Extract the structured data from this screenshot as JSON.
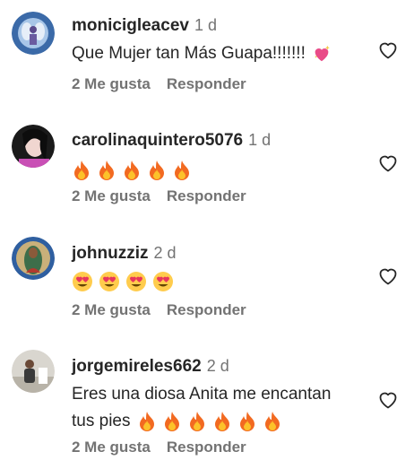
{
  "comments": [
    {
      "username": "monicigleacev",
      "time": "1 d",
      "text": "Que Mujer tan Más Guapa!!!!!!!",
      "emojis": [
        "sparkling-heart"
      ],
      "likes_label": "2 Me gusta",
      "reply_label": "Responder"
    },
    {
      "username": "carolinaquintero5076",
      "time": "1 d",
      "text": "",
      "emojis": [
        "fire",
        "fire",
        "fire",
        "fire",
        "fire"
      ],
      "likes_label": "2 Me gusta",
      "reply_label": "Responder"
    },
    {
      "username": "johnuzziz",
      "time": "2 d",
      "text": "",
      "emojis": [
        "heart-eyes",
        "heart-eyes",
        "heart-eyes",
        "heart-eyes"
      ],
      "likes_label": "2 Me gusta",
      "reply_label": "Responder"
    },
    {
      "username": "jorgemireles662",
      "time": "2 d",
      "text_line1": "Eres una diosa Anita me encantan",
      "text_line2": "tus pies",
      "emojis": [
        "fire",
        "fire",
        "fire",
        "fire",
        "fire",
        "fire"
      ],
      "likes_label": "2 Me gusta",
      "reply_label": "Responder"
    }
  ],
  "icons": {
    "like": "heart-outline-icon",
    "fire": "fire-emoji",
    "heart_eyes": "heart-eyes-emoji",
    "sparkling_heart": "sparkling-heart-emoji"
  },
  "colors": {
    "text": "#262626",
    "secondary": "#737373"
  }
}
